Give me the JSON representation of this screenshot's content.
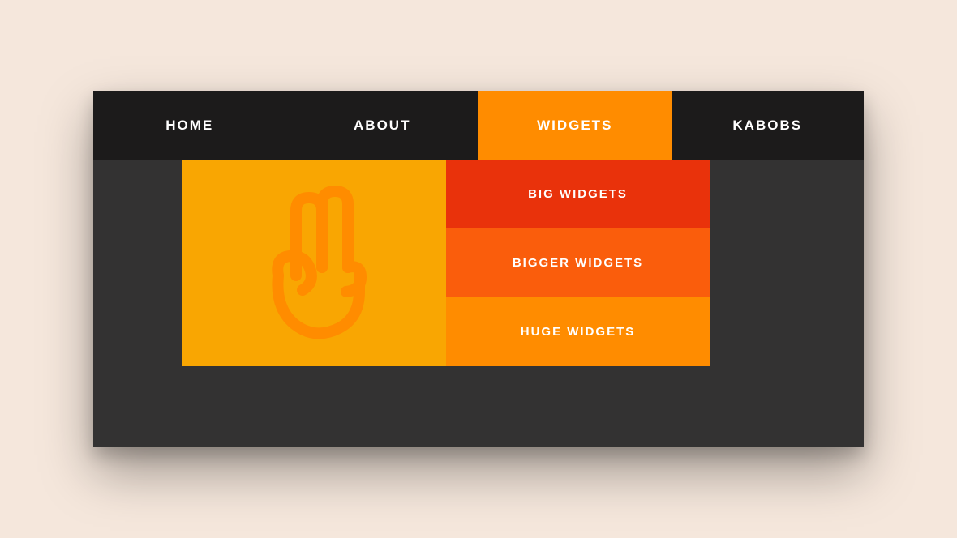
{
  "nav": {
    "items": [
      {
        "label": "HOME",
        "active": false
      },
      {
        "label": "ABOUT",
        "active": false
      },
      {
        "label": "WIDGETS",
        "active": true
      },
      {
        "label": "KABOBS",
        "active": false
      }
    ]
  },
  "dropdown": {
    "items": [
      {
        "label": "BIG WIDGETS"
      },
      {
        "label": "BIGGER WIDGETS"
      },
      {
        "label": "HUGE WIDGETS"
      }
    ]
  },
  "colors": {
    "page_bg": "#f5e7dc",
    "window_bg": "#333232",
    "navbar_bg": "#1c1b1b",
    "accent": "#ff8c00",
    "panel": "#f9a602",
    "sub1": "#e9320b",
    "sub2": "#fa5d0c",
    "sub3": "#ff8c00"
  },
  "icon": "peace-hand-icon"
}
